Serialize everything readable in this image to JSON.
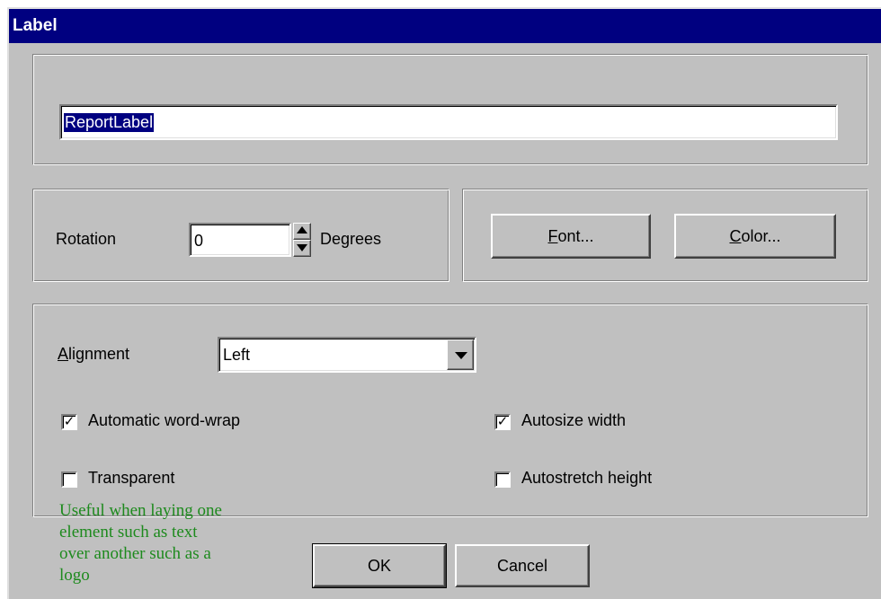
{
  "window": {
    "title": "Label"
  },
  "text_field": {
    "value": "ReportLabel"
  },
  "rotation": {
    "label": "Rotation",
    "value": "0",
    "unit": "Degrees"
  },
  "buttons": {
    "font_label_rest": "ont...",
    "font_label_key": "F",
    "color_label_key": "C",
    "color_label_rest": "olor...",
    "ok": "OK",
    "cancel": "Cancel"
  },
  "alignment": {
    "label_key": "A",
    "label_rest": "lignment",
    "selected": "Left"
  },
  "options": {
    "word_wrap": {
      "label": "Automatic word-wrap",
      "checked": true
    },
    "autosize_width": {
      "label": "Autosize width",
      "checked": true
    },
    "transparent": {
      "label": "Transparent",
      "checked": false
    },
    "autostretch_height": {
      "label": "Autostretch height",
      "checked": false
    }
  },
  "annotation": {
    "line1": "Useful when laying one",
    "line2": "element such as text",
    "line3": "over another such as a",
    "line4": "logo"
  }
}
